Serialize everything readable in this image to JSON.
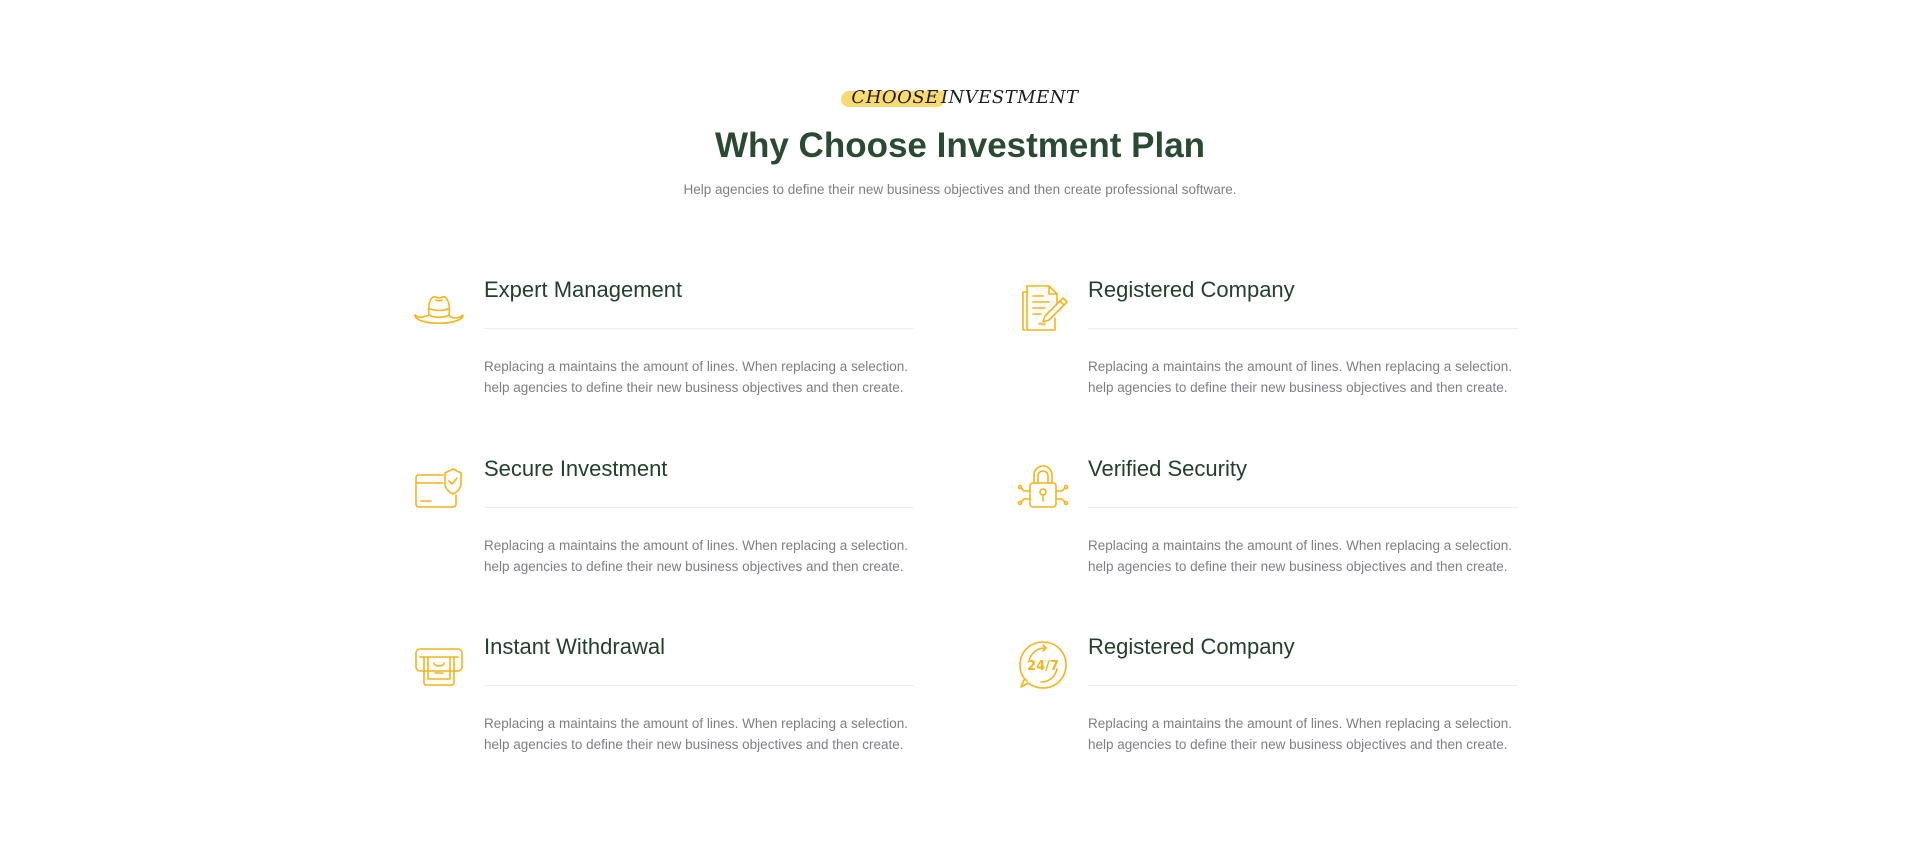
{
  "header": {
    "eyebrow_highlight": "CHOOSE",
    "eyebrow_rest": "INVESTMENT",
    "title": "Why Choose Investment Plan",
    "subtitle": "Help agencies to define their new business objectives and then create professional software."
  },
  "features": [
    {
      "title": "Expert Management",
      "icon": "hat-icon",
      "desc_line1": "Replacing a maintains the amount of lines. When replacing a selection.",
      "desc_line2": "help agencies to define their new business objectives and then create."
    },
    {
      "title": "Registered Company",
      "icon": "document-edit-icon",
      "desc_line1": "Replacing a maintains the amount of lines. When replacing a selection.",
      "desc_line2": "help agencies to define their new business objectives and then create."
    },
    {
      "title": "Secure Investment",
      "icon": "secure-card-icon",
      "desc_line1": "Replacing a maintains the amount of lines. When replacing a selection.",
      "desc_line2": "help agencies to define their new business objectives and then create."
    },
    {
      "title": "Verified Security",
      "icon": "padlock-icon",
      "desc_line1": "Replacing a maintains the amount of lines. When replacing a selection.",
      "desc_line2": "help agencies to define their new business objectives and then create."
    },
    {
      "title": "Instant Withdrawal",
      "icon": "atm-withdrawal-icon",
      "desc_line1": "Replacing a maintains the amount of lines. When replacing a selection.",
      "desc_line2": "help agencies to define their new business objectives and then create."
    },
    {
      "title": "Registered Company",
      "icon": "support-24-7-icon",
      "icon_text": "24/7",
      "desc_line1": "Replacing a maintains the amount of lines. When replacing a selection.",
      "desc_line2": "help agencies to define their new business objectives and then create."
    }
  ],
  "colors": {
    "accent": "#f4b41a",
    "highlight": "#f8d660",
    "heading": "#2a4a32",
    "body_text": "#7b7f86",
    "divider": "#eeeeee"
  }
}
